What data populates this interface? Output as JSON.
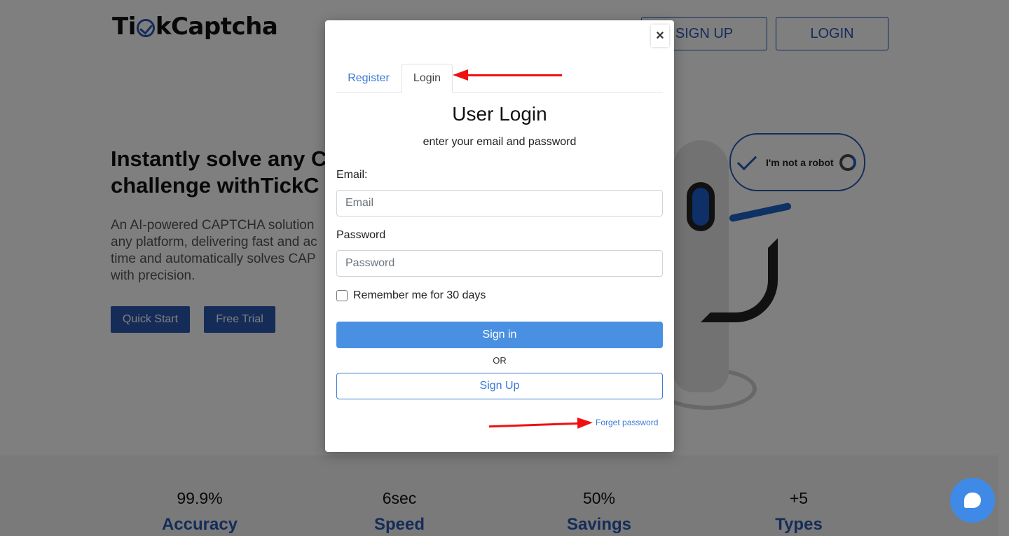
{
  "header": {
    "logo_text_before": "Ti",
    "logo_text_after": "kCaptcha",
    "signup_label": "SIGN UP",
    "login_label": "LOGIN"
  },
  "hero": {
    "title": "Instantly solve any C\nchallenge withTickC",
    "description": "An AI-powered CAPTCHA solution\nany platform, delivering fast and ac\ntime and automatically solves CAP\nwith precision.",
    "quick_start_label": "Quick Start",
    "free_trial_label": "Free Trial"
  },
  "illustration": {
    "badge_text": "I'm not a robot"
  },
  "stats": [
    {
      "value": "99.9%",
      "label": "Accuracy"
    },
    {
      "value": "6sec",
      "label": "Speed"
    },
    {
      "value": "50%",
      "label": "Savings"
    },
    {
      "value": "+5",
      "label": "Types"
    }
  ],
  "modal": {
    "close_label": "×",
    "tabs": [
      {
        "label": "Register",
        "active": false
      },
      {
        "label": "Login",
        "active": true
      }
    ],
    "title": "User Login",
    "subtitle": "enter your email and password",
    "email_label": "Email:",
    "email_placeholder": "Email",
    "email_value": "",
    "password_label": "Password",
    "password_placeholder": "Password",
    "password_value": "",
    "remember_label": "Remember me for 30 days",
    "remember_checked": false,
    "signin_label": "Sign in",
    "or_text": "OR",
    "signup_label": "Sign Up",
    "forget_label": "Forget password"
  },
  "colors": {
    "brand_blue": "#2a59b3",
    "signin_blue": "#4a90e2",
    "annotation_red": "#f01010",
    "chat_blue": "#3f8ae6"
  }
}
